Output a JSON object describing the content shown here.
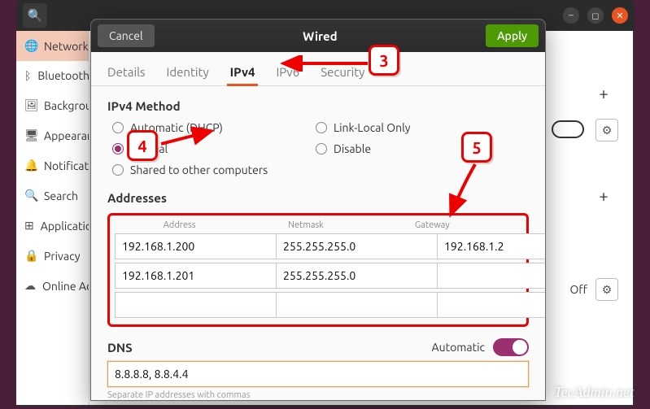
{
  "bg": {
    "sidebar": [
      {
        "icon": "🌐",
        "label": "Network",
        "active": true
      },
      {
        "icon": "ᛒ",
        "label": "Bluetooth"
      },
      {
        "icon": "🖼",
        "label": "Background"
      },
      {
        "icon": "🖥",
        "label": "Appearance"
      },
      {
        "icon": "🔔",
        "label": "Notifications"
      },
      {
        "icon": "🔍",
        "label": "Search"
      },
      {
        "icon": "⊞",
        "label": "Applications"
      },
      {
        "icon": "🔒",
        "label": "Privacy"
      },
      {
        "icon": "☁",
        "label": "Online Accounts"
      }
    ],
    "row_off_label": "Off"
  },
  "dialog": {
    "cancel": "Cancel",
    "title": "Wired",
    "apply": "Apply",
    "tabs": [
      "Details",
      "Identity",
      "IPv4",
      "IPv6",
      "Security"
    ],
    "active_tab": 2,
    "ipv4_method_label": "IPv4 Method",
    "methods": {
      "auto": "Automatic (DHCP)",
      "link": "Link-Local Only",
      "manual": "Manual",
      "disable": "Disable",
      "shared": "Shared to other computers"
    },
    "selected_method": "manual",
    "addresses_label": "Addresses",
    "addr_headers": {
      "address": "Address",
      "netmask": "Netmask",
      "gateway": "Gateway"
    },
    "addresses": [
      {
        "address": "192.168.1.200",
        "netmask": "255.255.255.0",
        "gateway": "192.168.1.2"
      },
      {
        "address": "192.168.1.201",
        "netmask": "255.255.255.0",
        "gateway": ""
      },
      {
        "address": "",
        "netmask": "",
        "gateway": ""
      }
    ],
    "dns_label": "DNS",
    "dns_auto_label": "Automatic",
    "dns_value": "8.8.8.8, 8.8.4.4",
    "dns_hint": "Separate IP addresses with commas"
  },
  "callouts": {
    "3": "3",
    "4": "4",
    "5": "5"
  },
  "watermark": "TecAdmin.net"
}
